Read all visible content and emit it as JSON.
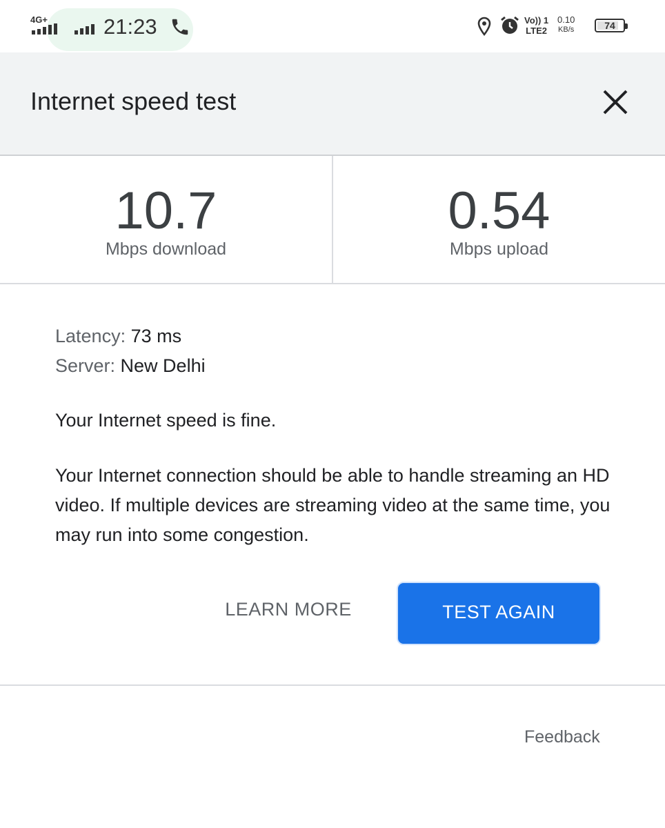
{
  "status_bar": {
    "network": "4G+",
    "time": "21:23",
    "volte_top": "Vo)) 1",
    "volte_bottom": "LTE2",
    "speed_value": "0.10",
    "speed_unit": "KB/s",
    "battery": "74"
  },
  "header": {
    "title": "Internet speed test"
  },
  "metrics": {
    "download": {
      "value": "10.7",
      "label": "Mbps download"
    },
    "upload": {
      "value": "0.54",
      "label": "Mbps upload"
    }
  },
  "details": {
    "latency_label": "Latency:",
    "latency_value": "73 ms",
    "server_label": "Server:",
    "server_value": "New Delhi"
  },
  "verdict": "Your Internet speed is fine.",
  "description": "Your Internet connection should be able to handle streaming an HD video. If multiple devices are streaming video at the same time, you may run into some congestion.",
  "actions": {
    "learn_more": "LEARN MORE",
    "test_again": "TEST AGAIN"
  },
  "footer": {
    "feedback": "Feedback"
  },
  "colors": {
    "primary_button": "#1a73e8",
    "header_bg": "#f1f3f4"
  },
  "icons": [
    "signal-icon",
    "phone-icon",
    "location-icon",
    "alarm-icon",
    "battery-icon",
    "close-icon"
  ]
}
